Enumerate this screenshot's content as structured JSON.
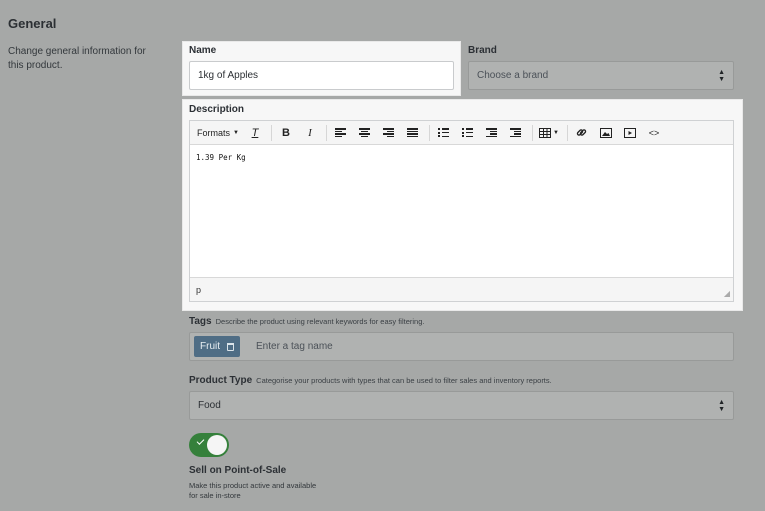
{
  "general": {
    "title": "General",
    "description": "Change general information for this product."
  },
  "name": {
    "label": "Name",
    "value": "1kg of Apples"
  },
  "brand": {
    "label": "Brand",
    "placeholder": "Choose a brand"
  },
  "description": {
    "label": "Description",
    "toolbar": {
      "formats_label": "Formats",
      "bold": "B",
      "italic": "I",
      "code": "<>"
    },
    "content": "1.39 Per Kg",
    "status_path": "p"
  },
  "tags": {
    "label": "Tags",
    "hint": "Describe the product using relevant keywords for easy filtering.",
    "items": [
      {
        "label": "Fruit"
      }
    ],
    "placeholder": "Enter a tag name"
  },
  "product_type": {
    "label": "Product Type",
    "hint": "Categorise your products with types that can be used to filter sales and inventory reports.",
    "value": "Food"
  },
  "pos": {
    "label": "Sell on Point-of-Sale",
    "description_line1": "Make this product active and available",
    "description_line2": "for sale in-store",
    "enabled": true
  },
  "colors": {
    "tag_bg": "#4f6d85",
    "toggle_on": "#35803b",
    "overlay_bg": "#a6a8a7"
  }
}
